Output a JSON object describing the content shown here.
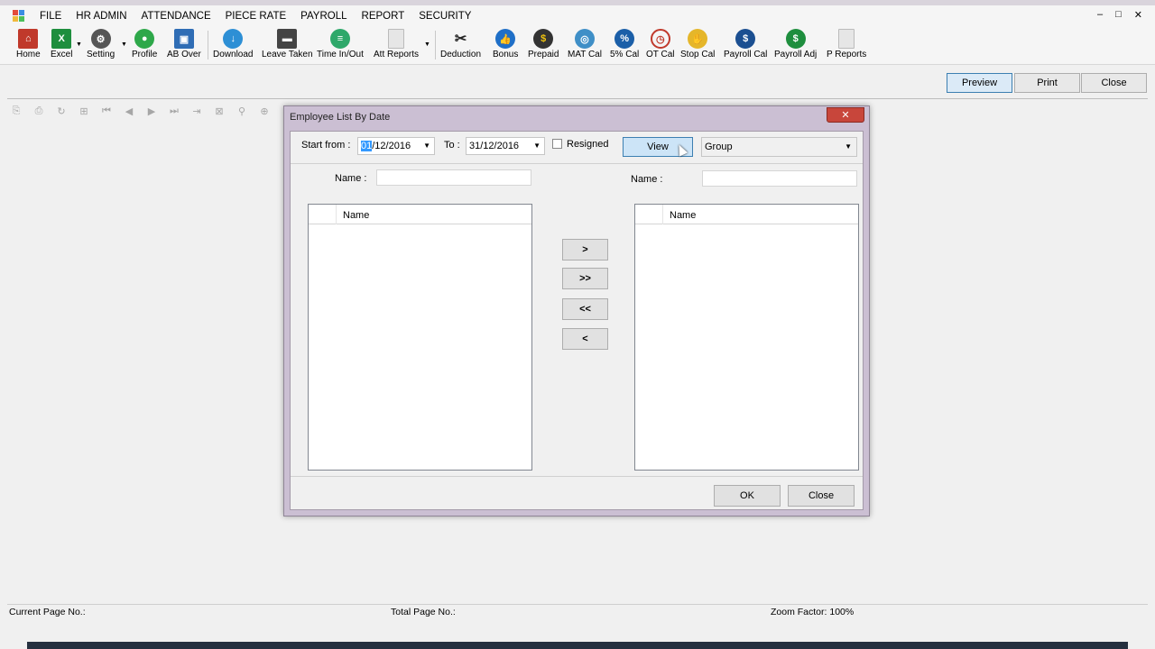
{
  "menu": [
    "FILE",
    "HR ADMIN",
    "ATTENDANCE",
    "PIECE RATE",
    "PAYROLL",
    "REPORT",
    "SECURITY"
  ],
  "window_controls": {
    "minimize": "–",
    "maximize": "□",
    "close": "✕"
  },
  "toolbar": [
    {
      "label": "Home",
      "icon": "home-icon",
      "color": "#c0392b"
    },
    {
      "label": "Excel",
      "icon": "excel-icon",
      "color": "#1e8e3e"
    },
    {
      "label": "Setting",
      "icon": "gear-icon",
      "color": "#555555"
    },
    {
      "label": "Profile",
      "icon": "profile-icon",
      "color": "#2ea84a"
    },
    {
      "label": "AB Over",
      "icon": "ab-over-icon",
      "color": "#2f6db5"
    },
    {
      "label": "Download",
      "icon": "download-icon",
      "color": "#2d8fd5"
    },
    {
      "label": "Leave Taken",
      "icon": "leave-icon",
      "color": "#444444"
    },
    {
      "label": "Time In/Out",
      "icon": "clock-icon",
      "color": "#2ea86a"
    },
    {
      "label": "Att Reports",
      "icon": "report-icon",
      "color": "#d0d0d0"
    },
    {
      "label": "Deduction",
      "icon": "scissors-icon",
      "color": "#222222"
    },
    {
      "label": "Bonus",
      "icon": "thumbs-up-icon",
      "color": "#1f6fc7"
    },
    {
      "label": "Prepaid",
      "icon": "prepaid-icon",
      "color": "#333333"
    },
    {
      "label": "MAT Cal",
      "icon": "mat-icon",
      "color": "#3f8fc7"
    },
    {
      "label": "5% Cal",
      "icon": "percent-icon",
      "color": "#1b5fa8"
    },
    {
      "label": "OT Cal",
      "icon": "ot-clock-icon",
      "color": "#c0392b"
    },
    {
      "label": "Stop Cal",
      "icon": "stop-icon",
      "color": "#e5b62a"
    },
    {
      "label": "Payroll Cal",
      "icon": "payroll-icon",
      "color": "#1b4f91"
    },
    {
      "label": "Payroll Adj",
      "icon": "payroll-adj-icon",
      "color": "#1e8e3e"
    },
    {
      "label": "P Reports",
      "icon": "p-reports-icon",
      "color": "#d0d0d0"
    }
  ],
  "report_buttons": {
    "preview": "Preview",
    "print": "Print",
    "close": "Close"
  },
  "viewer_tools": [
    "export-icon",
    "print-icon",
    "refresh-icon",
    "tree-icon",
    "first-page-icon",
    "prev-page-icon",
    "next-page-icon",
    "last-page-icon",
    "goto-icon",
    "stop-icon",
    "find-icon",
    "zoom-icon"
  ],
  "status": {
    "current_page": "Current Page No.:",
    "total_page": "Total Page No.:",
    "zoom": "Zoom Factor: 100%"
  },
  "dialog": {
    "title": "Employee List By Date",
    "close_glyph": "✕",
    "start_label": "Start from :",
    "start_value_selected": "01",
    "start_value_rest": "/12/2016",
    "to_label": "To :",
    "to_value": "31/12/2016",
    "resigned_label": "Resigned",
    "view_label": "View",
    "group_value": "Group",
    "name_label_left": "Name :",
    "name_label_right": "Name :",
    "list_header_left": "Name",
    "list_header_right": "Name",
    "move_buttons": [
      ">",
      ">>",
      "<<",
      "<"
    ],
    "ok_label": "OK",
    "close_label": "Close"
  }
}
